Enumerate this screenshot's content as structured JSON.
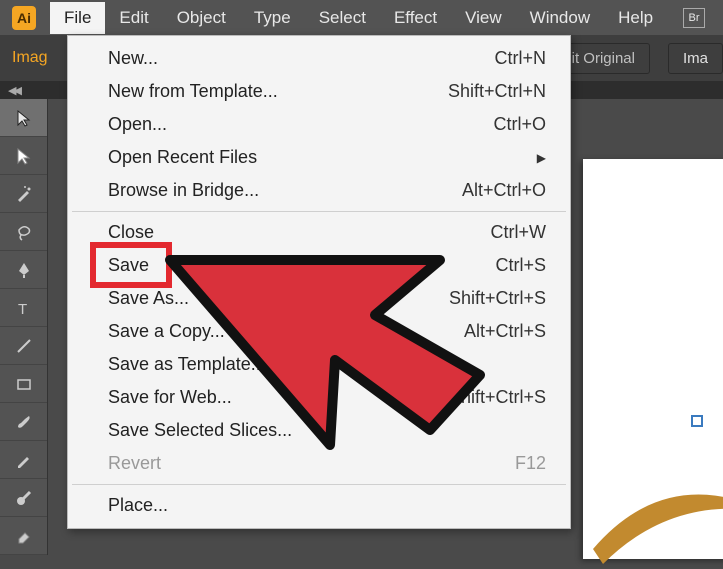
{
  "app": {
    "logo_text": "Ai"
  },
  "menubar": {
    "items": [
      "File",
      "Edit",
      "Object",
      "Type",
      "Select",
      "Effect",
      "View",
      "Window",
      "Help"
    ],
    "active_index": 0,
    "br_badge": "Br"
  },
  "toolbar": {
    "mode_label": "Imag",
    "edit_original": "dit Original",
    "ima_btn": "Ima"
  },
  "collapse": {
    "chev": "◀◀"
  },
  "palette_tools": [
    "selection-tool",
    "direct-selection-tool",
    "magic-wand-tool",
    "lasso-tool",
    "pen-tool",
    "type-tool",
    "line-segment-tool",
    "rectangle-tool",
    "paintbrush-tool",
    "pencil-tool",
    "blob-brush-tool",
    "eraser-tool"
  ],
  "file_menu": [
    {
      "label": "New...",
      "shortcut": "Ctrl+N",
      "type": "item"
    },
    {
      "label": "New from Template...",
      "shortcut": "Shift+Ctrl+N",
      "type": "item"
    },
    {
      "label": "Open...",
      "shortcut": "Ctrl+O",
      "type": "item"
    },
    {
      "label": "Open Recent Files",
      "shortcut": "",
      "type": "submenu"
    },
    {
      "label": "Browse in Bridge...",
      "shortcut": "Alt+Ctrl+O",
      "type": "item"
    },
    {
      "type": "sep"
    },
    {
      "label": "Close",
      "shortcut": "Ctrl+W",
      "type": "item"
    },
    {
      "label": "Save",
      "shortcut": "Ctrl+S",
      "type": "item",
      "highlighted": true
    },
    {
      "label": "Save As...",
      "shortcut": "Shift+Ctrl+S",
      "type": "item"
    },
    {
      "label": "Save a Copy...",
      "shortcut": "Alt+Ctrl+S",
      "type": "item"
    },
    {
      "label": "Save as Template...",
      "shortcut": "",
      "type": "item"
    },
    {
      "label": "Save for Web...",
      "shortcut": "Alt+Shift+Ctrl+S",
      "type": "item"
    },
    {
      "label": "Save Selected Slices...",
      "shortcut": "",
      "type": "item"
    },
    {
      "label": "Revert",
      "shortcut": "F12",
      "type": "item",
      "disabled": true
    },
    {
      "type": "sep"
    },
    {
      "label": "Place...",
      "shortcut": "",
      "type": "item"
    }
  ]
}
